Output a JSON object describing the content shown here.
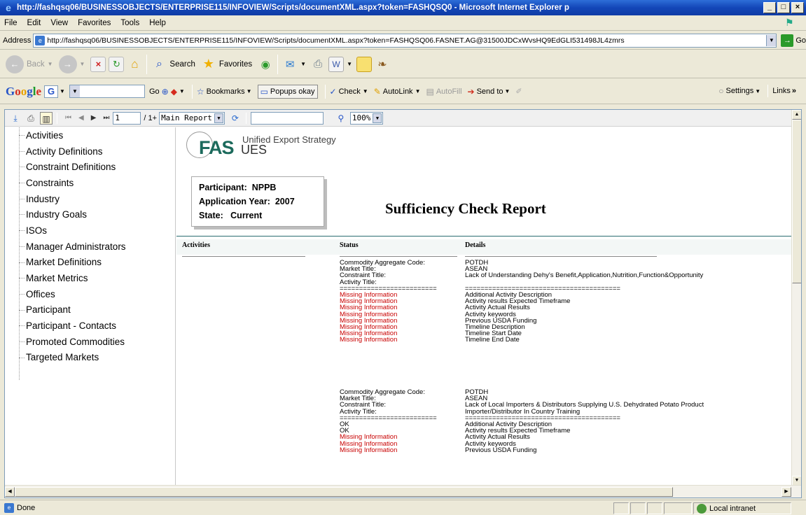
{
  "window": {
    "title": "http://fashqsq06/BUSINESSOBJECTS/ENTERPRISE115/INFOVIEW/Scripts/documentXML.aspx?token=FASHQSQ0 - Microsoft Internet Explorer p",
    "minimize": "_",
    "maximize": "□",
    "close": "×"
  },
  "menu": [
    "File",
    "Edit",
    "View",
    "Favorites",
    "Tools",
    "Help"
  ],
  "address": {
    "label": "Address",
    "url": "http://fashqsq06/BUSINESSOBJECTS/ENTERPRISE115/INFOVIEW/Scripts/documentXML.aspx?token=FASHQSQ06.FASNET.AG@31500JDCxWvsHQ9EdGLI531498JL4zmrs",
    "go": "Go"
  },
  "toolbar": {
    "back": "Back",
    "search": "Search",
    "favorites": "Favorites"
  },
  "google_toolbar": {
    "go": "Go",
    "bookmarks": "Bookmarks",
    "popups": "Popups okay",
    "check": "Check",
    "autolink": "AutoLink",
    "autofill": "AutoFill",
    "sendto": "Send to",
    "settings": "Settings",
    "links": "Links"
  },
  "report_toolbar": {
    "page": "1",
    "page_total": "/ 1+",
    "view": "Main Report",
    "zoom": "100%"
  },
  "tree": [
    "Activities",
    "Activity Definitions",
    "Constraint Definitions",
    "Constraints",
    "Industry",
    "Industry Goals",
    "ISOs",
    "Manager Administrators",
    "Market Definitions",
    "Market Metrics",
    "Offices",
    "Participant",
    "Participant - Contacts",
    "Promoted Commodities",
    "Targeted Markets"
  ],
  "report": {
    "logo_fas": "FAS",
    "logo_ues": "UES",
    "logo_tagline": "Unified Export Strategy",
    "participant_label": "Participant:",
    "participant": "NPPB",
    "app_year_label": "Application Year:",
    "app_year": "2007",
    "state_label": "State:",
    "state": "Current",
    "title": "Sufficiency Check Report",
    "col_activities": "Activities",
    "col_status": "Status",
    "col_details": "Details",
    "blocks": [
      {
        "header_labels": [
          "Commodity Aggregate Code:",
          "Market Title:",
          "Constraint Title:",
          "Activity Title:"
        ],
        "header_values": [
          "POTDH",
          "ASEAN",
          "Lack of Understanding Dehy's Benefit,Application,Nutrition,Function&Opportunity",
          ""
        ],
        "sep_status": "=========================",
        "sep_details": "========================================",
        "rows": [
          {
            "status": "Missing Information",
            "missing": true,
            "detail": "Additional Activity Description"
          },
          {
            "status": "Missing Information",
            "missing": true,
            "detail": "Activity results Expected Timeframe"
          },
          {
            "status": "Missing Information",
            "missing": true,
            "detail": "Activity Actual Results"
          },
          {
            "status": "Missing Information",
            "missing": true,
            "detail": "Activity keywords"
          },
          {
            "status": "Missing Information",
            "missing": true,
            "detail": "Previous USDA Funding"
          },
          {
            "status": "Missing Information",
            "missing": true,
            "detail": "Timeline Description"
          },
          {
            "status": "Missing Information",
            "missing": true,
            "detail": "Timeline Start Date"
          },
          {
            "status": "Missing Information",
            "missing": true,
            "detail": "Timeline End Date"
          }
        ]
      },
      {
        "header_labels": [
          "Commodity Aggregate Code:",
          "Market Title:",
          "Constraint Title:",
          "Activity Title:"
        ],
        "header_values": [
          "POTDH",
          "ASEAN",
          "Lack of Local Importers & Distributors Supplying U.S. Dehydrated Potato Product",
          "Importer/Distributor In Country Training"
        ],
        "sep_status": "=========================",
        "sep_details": "========================================",
        "rows": [
          {
            "status": "OK",
            "missing": false,
            "detail": "Additional Activity Description"
          },
          {
            "status": "OK",
            "missing": false,
            "detail": "Activity results Expected Timeframe"
          },
          {
            "status": "Missing Information",
            "missing": true,
            "detail": "Activity Actual Results"
          },
          {
            "status": "Missing Information",
            "missing": true,
            "detail": "Activity keywords"
          },
          {
            "status": "Missing Information",
            "missing": true,
            "detail": "Previous USDA Funding"
          }
        ]
      }
    ]
  },
  "status_bar": {
    "text": "Done",
    "zone": "Local intranet"
  },
  "colors": {
    "title_bar": "#1346b8",
    "missing": "#c80000",
    "logo_green": "#1c6a5c",
    "rule": "#2a6c70"
  }
}
